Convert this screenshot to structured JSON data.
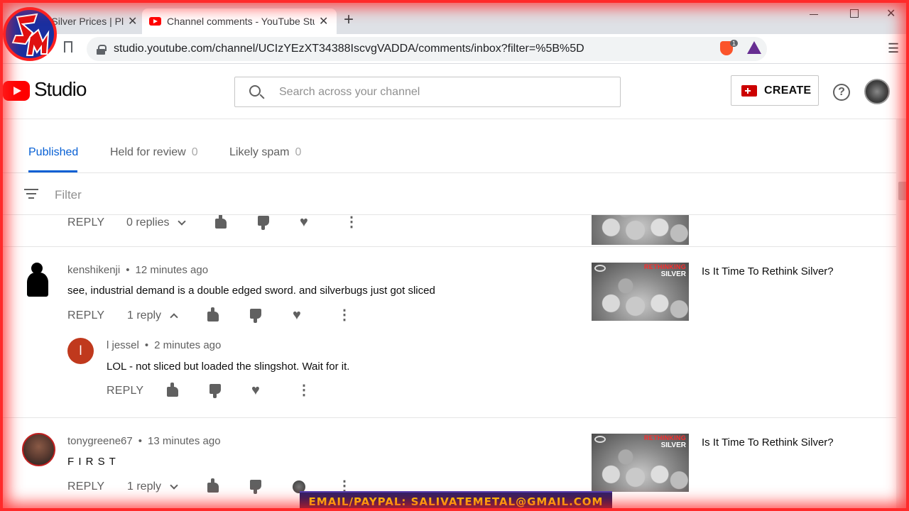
{
  "browser": {
    "tabs": [
      {
        "title": "s | Silver Prices | Pla"
      },
      {
        "title": "Channel comments - YouTube Stu"
      }
    ],
    "url": "studio.youtube.com/channel/UCIzYEzXT34388IscvgVADDA/comments/inbox?filter=%5B%5D",
    "brave_badge": "1",
    "new_tab_symbol": "+",
    "close_symbol": "✕"
  },
  "studio": {
    "wordmark": "Studio",
    "search_placeholder": "Search across your channel",
    "create_label": "CREATE",
    "help_symbol": "?"
  },
  "comment_tabs": [
    {
      "label": "Published",
      "count": ""
    },
    {
      "label": "Held for review",
      "count": "0"
    },
    {
      "label": "Likely spam",
      "count": "0"
    }
  ],
  "filter": {
    "label": "Filter"
  },
  "comments": [
    {
      "reply_label": "REPLY",
      "replies_label": "0 replies"
    },
    {
      "author": "kenshikenji",
      "time": "12 minutes ago",
      "text": "see, industrial demand is a double edged sword.  and silverbugs just got sliced",
      "reply_label": "REPLY",
      "replies_label": "1 reply",
      "video_title": "Is It Time To Rethink Silver?",
      "thumb_tag1": "RETHINKING",
      "thumb_tag2": "SILVER",
      "reply": {
        "author": "l jessel",
        "avatar_letter": "l",
        "time": "2 minutes ago",
        "text": "LOL - not sliced but loaded the slingshot. Wait for it.",
        "reply_label": "REPLY"
      }
    },
    {
      "author": "tonygreene67",
      "time": "13 minutes ago",
      "text": "F I R S T",
      "reply_label": "REPLY",
      "replies_label": "1 reply",
      "video_title": "Is It Time To Rethink Silver?",
      "thumb_tag1": "RETHINKING",
      "thumb_tag2": "SILVER"
    }
  ],
  "meta_separator": "•",
  "banner": {
    "text": "EMAIL/PAYPAL: SALIVATEMETAL@GMAIL.COM"
  },
  "colors": {
    "accent_blue": "#065fd4",
    "brand_red": "#ff0000",
    "frame_red": "#ff2a2a",
    "banner_text": "#ffd400",
    "banner_bg": "#14103f"
  }
}
